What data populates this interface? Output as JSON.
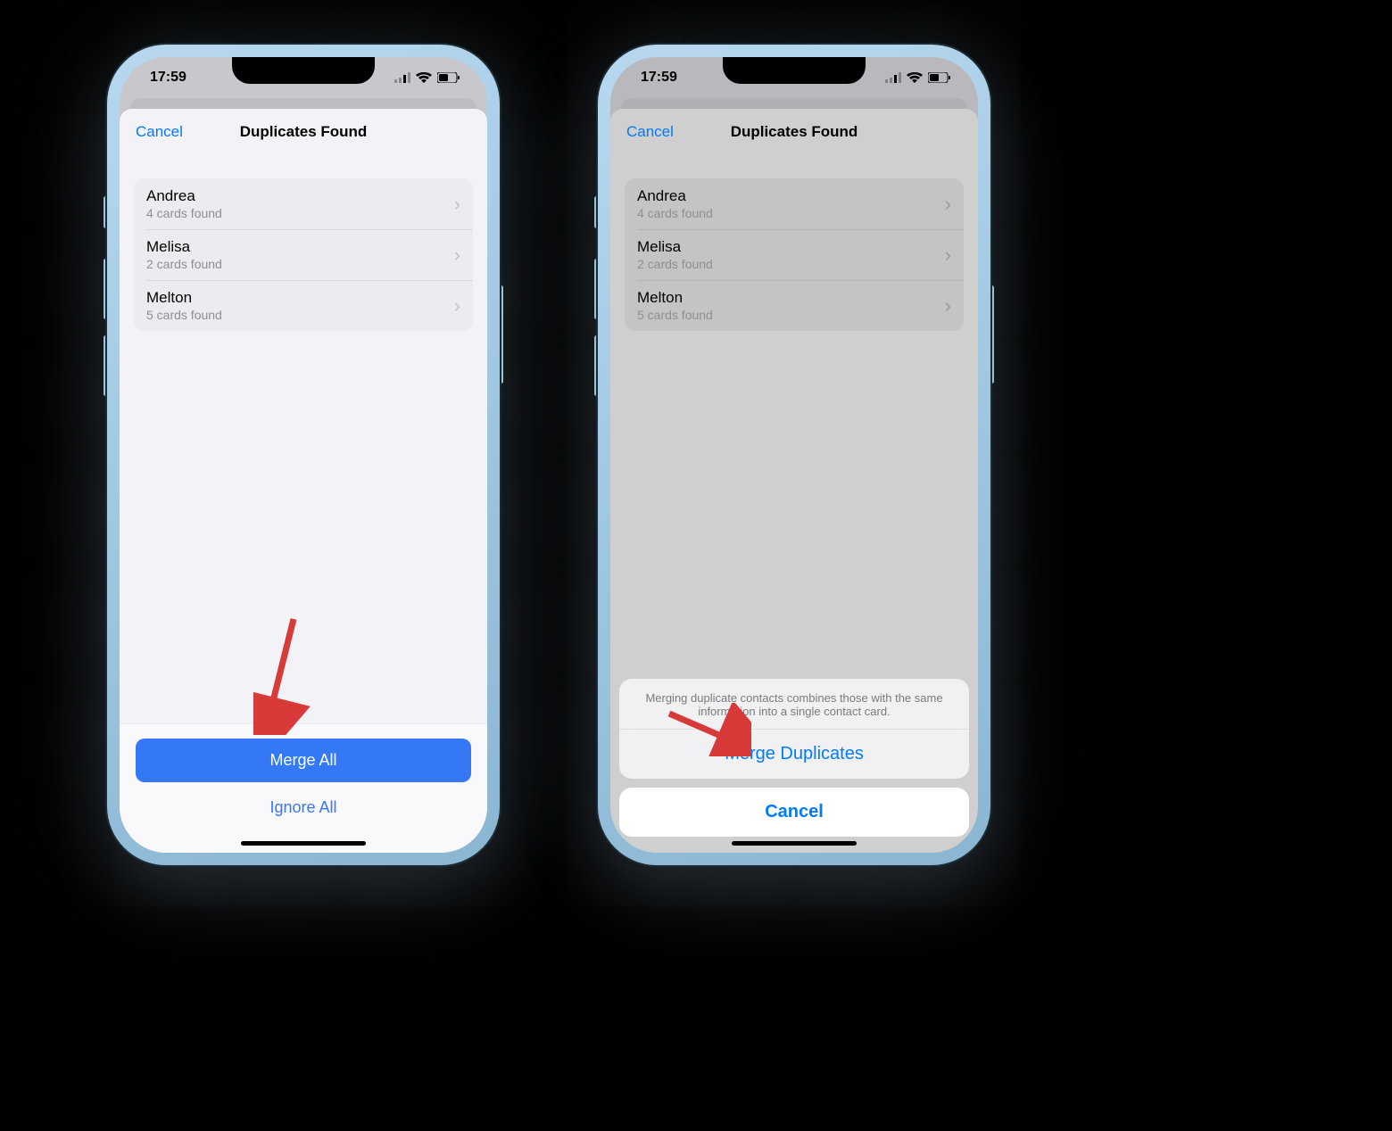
{
  "status": {
    "time": "17:59"
  },
  "nav": {
    "cancel": "Cancel",
    "title": "Duplicates Found"
  },
  "duplicates": [
    {
      "name": "Andrea",
      "sub": "4 cards found"
    },
    {
      "name": "Melisa",
      "sub": "2 cards found"
    },
    {
      "name": "Melton",
      "sub": "5 cards found"
    }
  ],
  "buttons": {
    "mergeAll": "Merge All",
    "ignoreAll": "Ignore All"
  },
  "actionSheet": {
    "message": "Merging duplicate contacts combines those with the same information into a single contact card.",
    "merge": "Merge Duplicates",
    "cancel": "Cancel"
  }
}
